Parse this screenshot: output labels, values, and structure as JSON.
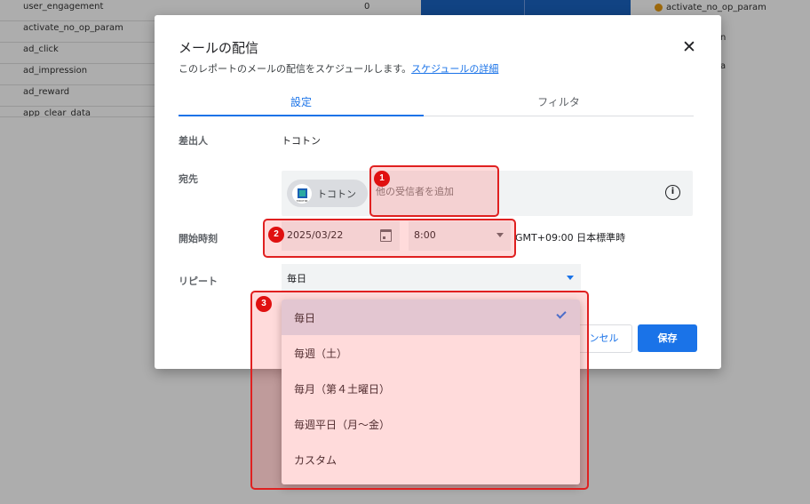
{
  "background": {
    "rows": [
      {
        "name": "user_engagement",
        "value": "0"
      },
      {
        "name": "activate_no_op_param",
        "value": ""
      },
      {
        "name": "ad_click",
        "value": ""
      },
      {
        "name": "ad_impression",
        "value": ""
      },
      {
        "name": "ad_reward",
        "value": ""
      },
      {
        "name": "app_clear_data",
        "value": ""
      }
    ],
    "legend_label": "activate_no_op_param",
    "legend_color": "#e89b13",
    "fragment_1": "n",
    "fragment_2": "a"
  },
  "dialog": {
    "title": "メールの配信",
    "subtitle": "このレポートのメールの配信をスケジュールします。",
    "details_link": "スケジュールの詳細",
    "close_label": "✕",
    "tabs": [
      "設定",
      "フィルタ"
    ],
    "sender_label": "差出人",
    "sender_value": "トコトン",
    "recipient_label": "宛先",
    "recipient_chip": "トコトン",
    "chip_logo_text": "TOKOTON",
    "recipient_placeholder": "他の受信者を追加",
    "start_label": "開始時刻",
    "date_value": "2025/03/22",
    "time_value": "8:00",
    "timezone": "GMT+09:00 日本標準時",
    "repeat_label": "リピート",
    "repeat_value": "毎日",
    "cancel_label": "ンセル",
    "save_label": "保存"
  },
  "repeat_menu": {
    "items": [
      "毎日",
      "毎週（土）",
      "毎月（第４土曜日）",
      "毎週平日（月〜金）",
      "カスタム"
    ],
    "selected_index": 0
  },
  "annotations": {
    "badges": [
      "1",
      "2",
      "3"
    ],
    "color": "#e02020"
  }
}
